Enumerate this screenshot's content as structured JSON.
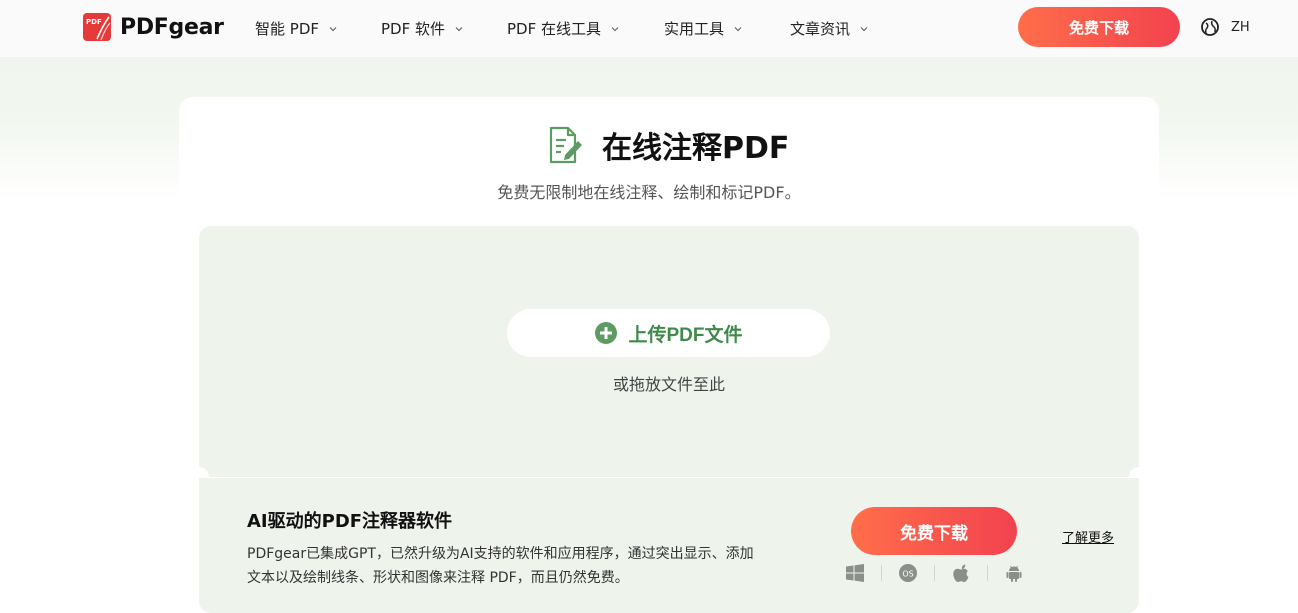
{
  "header": {
    "brand": "PDFgear",
    "logo_mark_text": "PDF",
    "nav": [
      {
        "label": "智能 PDF"
      },
      {
        "label": "PDF 软件"
      },
      {
        "label": "PDF 在线工具"
      },
      {
        "label": "实用工具"
      },
      {
        "label": "文章资讯"
      }
    ],
    "download_label": "免费下载",
    "language": "ZH"
  },
  "main": {
    "title": "在线注释PDF",
    "subtitle": "免费无限制地在线注释、绘制和标记PDF。",
    "upload_label": "上传PDF文件",
    "drop_hint": "或拖放文件至此"
  },
  "promo": {
    "title": "AI驱动的PDF注释器软件",
    "description": "PDFgear已集成GPT，已然升级为AI支持的软件和应用程序，通过突出显示、添加文本以及绘制线条、形状和图像来注释 PDF，而且仍然免费。",
    "download_label": "免费下载",
    "learn_more": "了解更多",
    "platforms": [
      "windows-icon",
      "macos-icon",
      "apple-icon",
      "android-icon"
    ]
  },
  "colors": {
    "accent_green": "#3f8a4a",
    "cta_start": "#ff6e4a",
    "cta_end": "#f2424f",
    "panel_bg": "#eef4ec",
    "brand_red": "#e63a3a"
  }
}
